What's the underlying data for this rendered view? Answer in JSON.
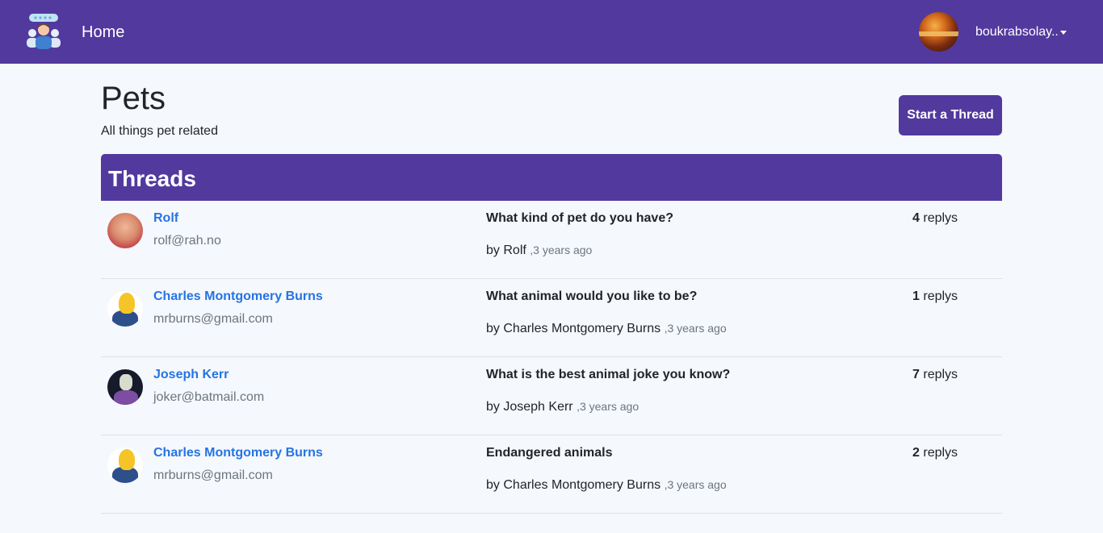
{
  "nav": {
    "logo_icon": "community-logo-icon",
    "home_label": "Home",
    "username": "boukrabsolay..",
    "brand_color": "#52399e"
  },
  "forum": {
    "title": "Pets",
    "description": "All things pet related",
    "start_thread_label": "Start a Thread"
  },
  "threads": {
    "heading": "Threads",
    "items": [
      {
        "author_name": "Rolf",
        "author_email": "rolf@rah.no",
        "title": "What kind of pet do you have?",
        "by_label": "by",
        "by_author": "Rolf",
        "time_ago": ",3 years ago",
        "reply_count": "4",
        "reply_label": "replys"
      },
      {
        "author_name": "Charles Montgomery Burns",
        "author_email": "mrburns@gmail.com",
        "title": "What animal would you like to be?",
        "by_label": "by",
        "by_author": "Charles Montgomery Burns",
        "time_ago": ",3 years ago",
        "reply_count": "1",
        "reply_label": "replys"
      },
      {
        "author_name": "Joseph Kerr",
        "author_email": "joker@batmail.com",
        "title": "What is the best animal joke you know?",
        "by_label": "by",
        "by_author": "Joseph Kerr",
        "time_ago": ",3 years ago",
        "reply_count": "7",
        "reply_label": "replys"
      },
      {
        "author_name": "Charles Montgomery Burns",
        "author_email": "mrburns@gmail.com",
        "title": "Endangered animals",
        "by_label": "by",
        "by_author": "Charles Montgomery Burns",
        "time_ago": ",3 years ago",
        "reply_count": "2",
        "reply_label": "replys"
      }
    ]
  }
}
